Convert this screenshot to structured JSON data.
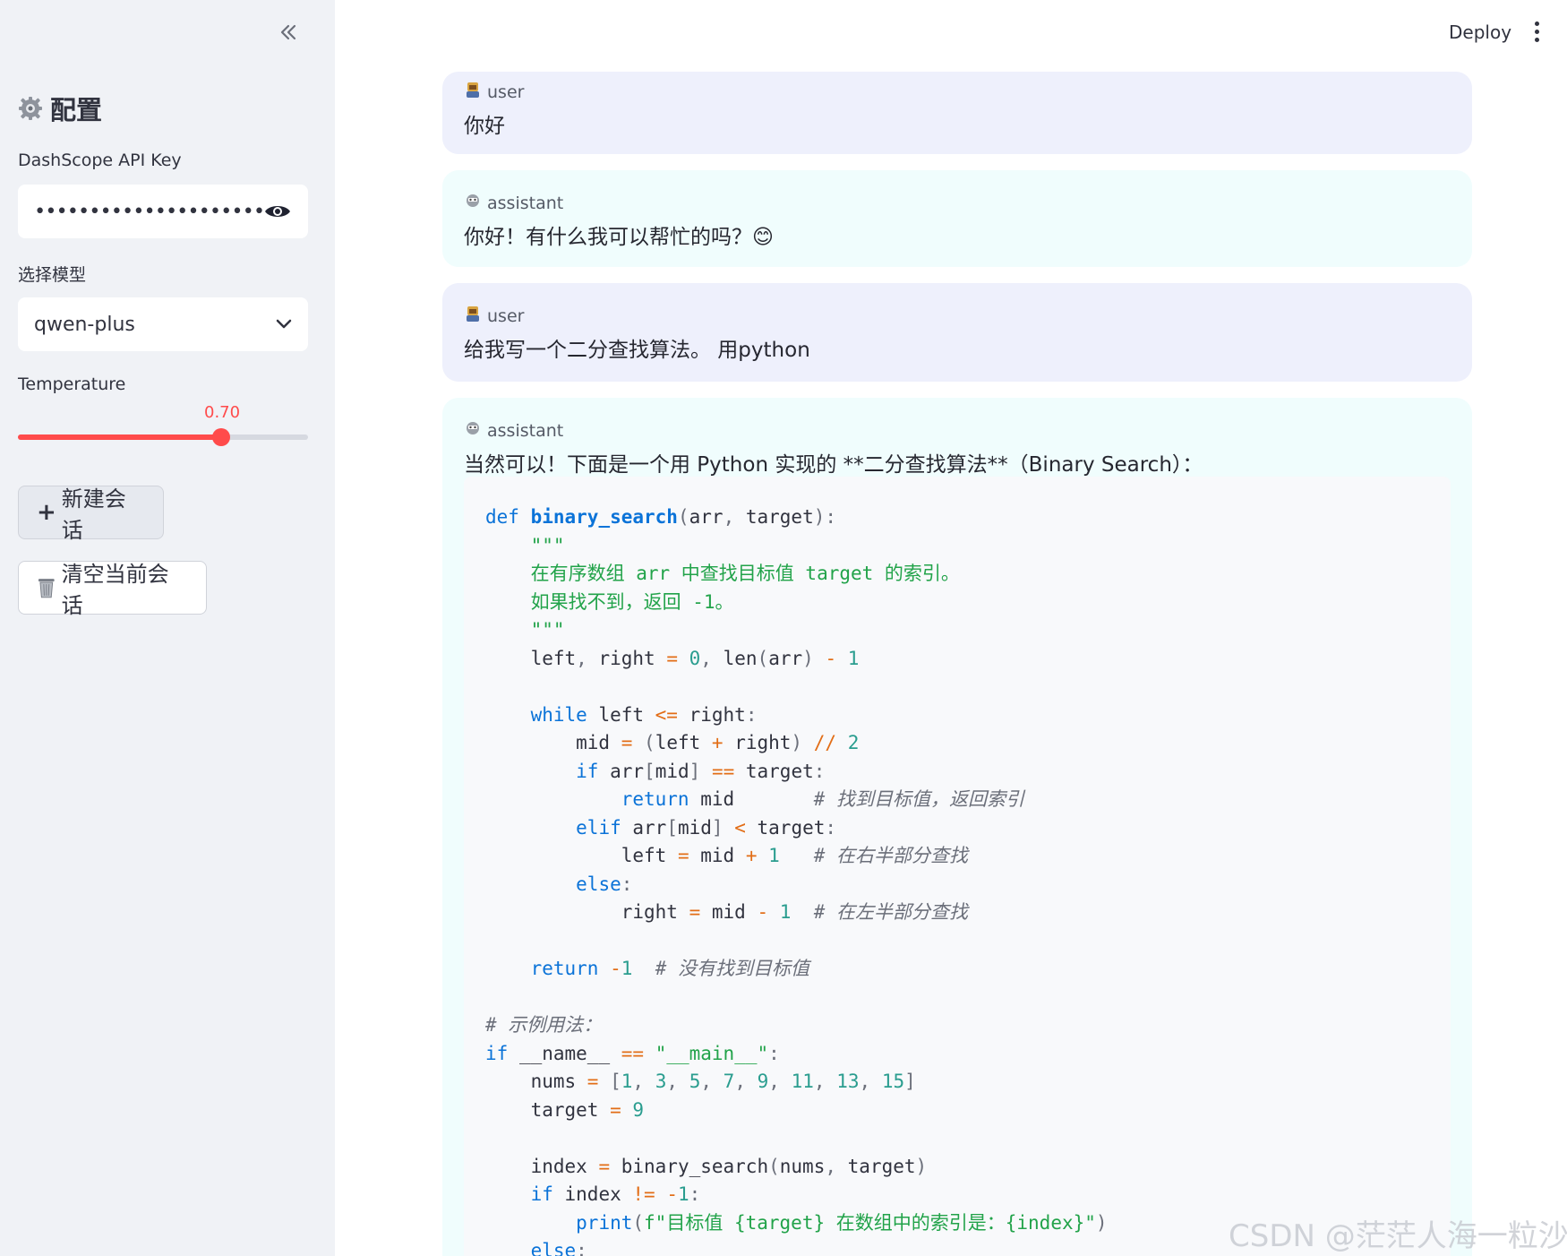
{
  "sidebar": {
    "title": "配置",
    "api_key_label": "DashScope API Key",
    "api_key_value": "••••••••••••••••••••••••••••••",
    "model_label": "选择模型",
    "model_value": "qwen-plus",
    "temperature_label": "Temperature",
    "temperature_value": "0.70",
    "temperature_fraction": 0.7,
    "new_chat_label": "新建会话",
    "clear_chat_label": "清空当前会话"
  },
  "header": {
    "deploy_label": "Deploy"
  },
  "messages": [
    {
      "role": "user",
      "text": "你好"
    },
    {
      "role": "assistant",
      "text": "你好！有什么我可以帮忙的吗？😊"
    },
    {
      "role": "user",
      "text": "给我写一个二分查找算法。 用python"
    },
    {
      "role": "assistant",
      "text": "当然可以！下面是一个用 Python 实现的 **二分查找算法**（Binary Search）："
    }
  ],
  "code": {
    "language": "python",
    "lines": [
      "def binary_search(arr, target):",
      "    \"\"\"",
      "    在有序数组 arr 中查找目标值 target 的索引。",
      "    如果找不到，返回 -1。",
      "    \"\"\"",
      "    left, right = 0, len(arr) - 1",
      "",
      "    while left <= right:",
      "        mid = (left + right) // 2",
      "        if arr[mid] == target:",
      "            return mid       # 找到目标值，返回索引",
      "        elif arr[mid] < target:",
      "            left = mid + 1   # 在右半部分查找",
      "        else:",
      "            right = mid - 1  # 在左半部分查找",
      "",
      "    return -1  # 没有找到目标值",
      "",
      "# 示例用法：",
      "if __name__ == \"__main__\":",
      "    nums = [1, 3, 5, 7, 9, 11, 13, 15]",
      "    target = 9",
      "",
      "    index = binary_search(nums, target)",
      "    if index != -1:",
      "        print(f\"目标值 {target} 在数组中的索引是：{index}\")",
      "    else:"
    ]
  },
  "watermark": "CSDN @茫茫人海一粒沙"
}
